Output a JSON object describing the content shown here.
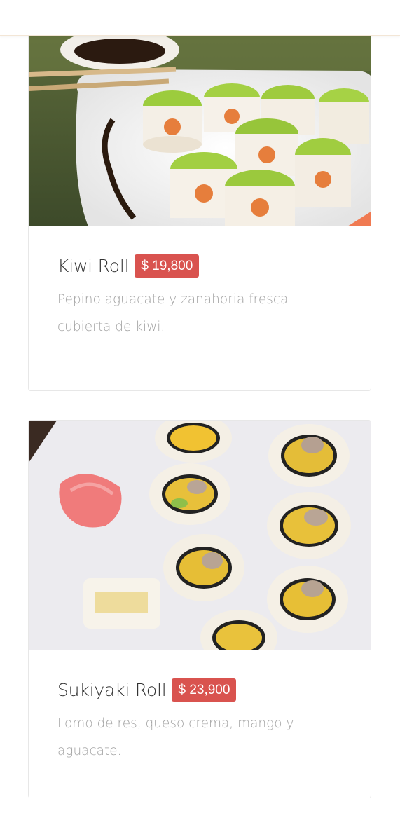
{
  "products": [
    {
      "name": "Kiwi Roll",
      "price": "$ 19,800",
      "description": "Pepino aguacate y zanahoria fresca cubierta de kiwi.",
      "image_icon": "sushi-kiwi-roll-photo"
    },
    {
      "name": "Sukiyaki Roll",
      "price": "$ 23,900",
      "description": "Lomo de res, queso crema, mango y aguacate.",
      "image_icon": "sushi-sukiyaki-roll-photo"
    }
  ],
  "colors": {
    "price_badge": "#d9534f",
    "title_text": "#333333",
    "description_text": "#a3a3a3",
    "card_border": "#e7e7e7"
  }
}
